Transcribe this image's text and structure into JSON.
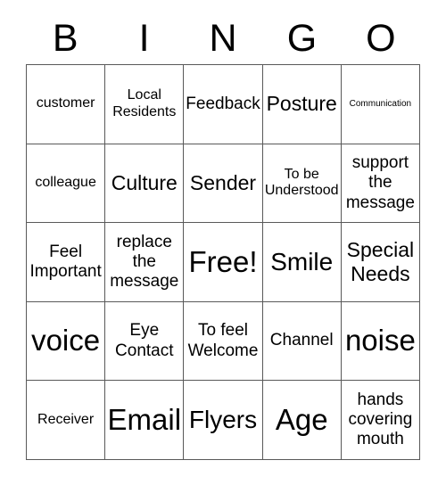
{
  "header": {
    "letters": [
      "B",
      "I",
      "N",
      "G",
      "O"
    ]
  },
  "grid": {
    "columns": 5,
    "rows": 5,
    "cells": [
      {
        "label": "customer",
        "size": "sm"
      },
      {
        "label": "Local Residents",
        "size": "sm"
      },
      {
        "label": "Feedback",
        "size": "md"
      },
      {
        "label": "Posture",
        "size": "lg"
      },
      {
        "label": "Communication",
        "size": "xs"
      },
      {
        "label": "colleague",
        "size": "sm"
      },
      {
        "label": "Culture",
        "size": "lg"
      },
      {
        "label": "Sender",
        "size": "lg"
      },
      {
        "label": "To be Understood",
        "size": "sm"
      },
      {
        "label": "support the message",
        "size": "md"
      },
      {
        "label": "Feel Important",
        "size": "md"
      },
      {
        "label": "replace the message",
        "size": "md"
      },
      {
        "label": "Free!",
        "size": "xxl"
      },
      {
        "label": "Smile",
        "size": "xl"
      },
      {
        "label": "Special Needs",
        "size": "lg"
      },
      {
        "label": "voice",
        "size": "xxl"
      },
      {
        "label": "Eye Contact",
        "size": "md"
      },
      {
        "label": "To feel Welcome",
        "size": "md"
      },
      {
        "label": "Channel",
        "size": "md"
      },
      {
        "label": "noise",
        "size": "xxl"
      },
      {
        "label": "Receiver",
        "size": "sm"
      },
      {
        "label": "Email",
        "size": "xxl"
      },
      {
        "label": "Flyers",
        "size": "xl"
      },
      {
        "label": "Age",
        "size": "xxl"
      },
      {
        "label": "hands covering mouth",
        "size": "md"
      }
    ]
  },
  "colors": {
    "background": "#ffffff",
    "text": "#000000",
    "grid_line": "#595959"
  }
}
